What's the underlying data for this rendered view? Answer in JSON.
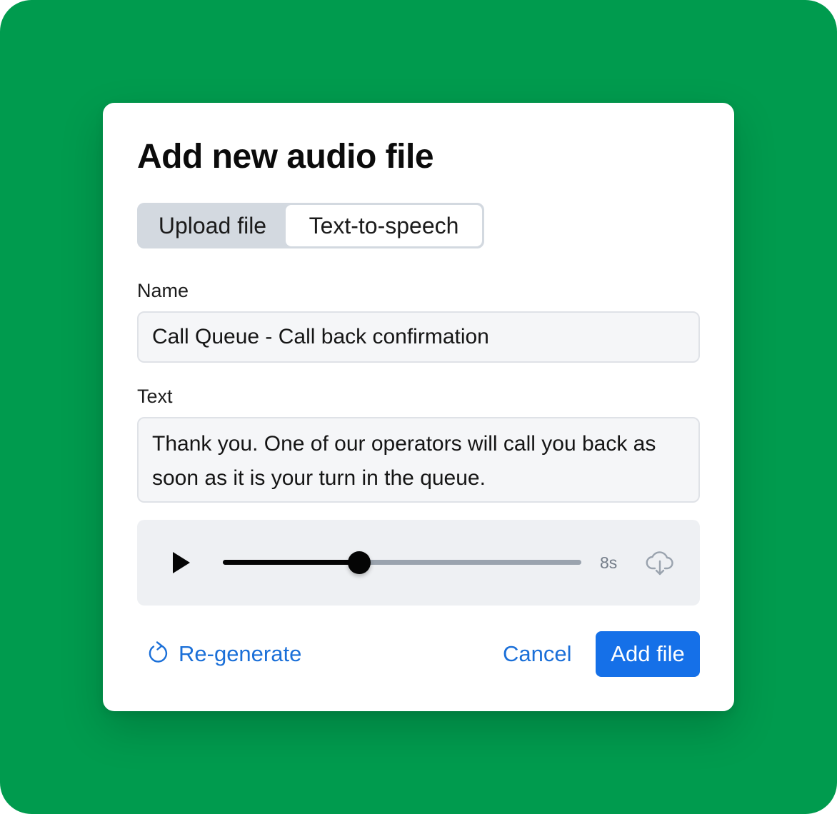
{
  "dialog": {
    "title": "Add new audio file"
  },
  "tabs": [
    {
      "label": "Upload file",
      "selected": false
    },
    {
      "label": "Text-to-speech",
      "selected": true
    }
  ],
  "name_field": {
    "label": "Name",
    "value": "Call Queue - Call back confirmation"
  },
  "text_field": {
    "label": "Text",
    "value": "Thank you. One of our operators will call you back as soon as it is your turn in the queue."
  },
  "player": {
    "play_icon": "play-icon",
    "progress_fraction": 0.38,
    "duration": "8s",
    "download_icon": "cloud-download-icon"
  },
  "footer": {
    "regenerate_icon": "refresh-icon",
    "regenerate_label": "Re-generate",
    "cancel_label": "Cancel",
    "add_label": "Add file"
  },
  "colors": {
    "background": "#009b4e",
    "accent": "#1570e8",
    "link": "#1a6fd8"
  }
}
